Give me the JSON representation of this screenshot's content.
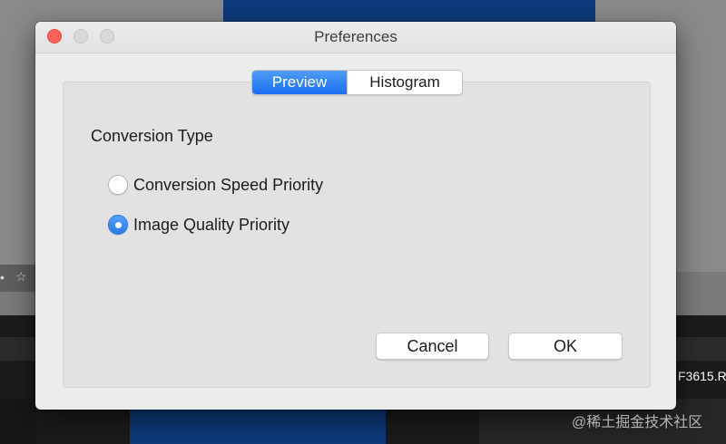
{
  "background": {
    "filename_fragment": "F3615.R",
    "toolbar_icons": [
      "bullet-icon",
      "star-icon"
    ],
    "bullet_glyph": "•",
    "star_glyph": "☆"
  },
  "watermark": "@稀土掘金技术社区",
  "dialog": {
    "title": "Preferences",
    "tabs": [
      {
        "label": "Preview",
        "selected": true
      },
      {
        "label": "Histogram",
        "selected": false
      }
    ],
    "section_label": "Conversion Type",
    "options": [
      {
        "label": "Conversion Speed Priority",
        "checked": false
      },
      {
        "label": "Image Quality Priority",
        "checked": true
      }
    ],
    "buttons": {
      "cancel": "Cancel",
      "ok": "OK"
    }
  },
  "colors": {
    "accent": "#1a6ff0",
    "close_button": "#fc605b",
    "window_bg": "#ececec"
  }
}
